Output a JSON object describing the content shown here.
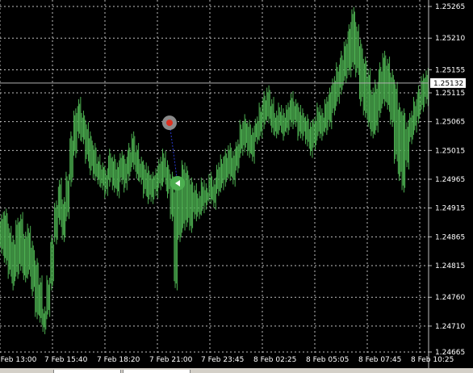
{
  "chart_data": {
    "type": "line",
    "title": "",
    "current_price": "1.25132",
    "price_ticks": [
      "1.25265",
      "1.25210",
      "1.25155",
      "1.25115",
      "1.25065",
      "1.25015",
      "1.24965",
      "1.24915",
      "1.24865",
      "1.24815",
      "1.24760",
      "1.24710",
      "1.24665"
    ],
    "time_ticks": [
      "7 Feb 13:00",
      "7 Feb 15:40",
      "7 Feb 18:20",
      "7 Feb 21:00",
      "7 Feb 23:45",
      "8 Feb 02:25",
      "8 Feb 05:05",
      "8 Feb 07:45",
      "8 Feb 10:25"
    ],
    "ylim": [
      1.2465,
      1.2528
    ],
    "grid": true,
    "bar_color": "#4caf50",
    "grid_color": "#c0c0c0",
    "price_line_color": "#b0b0b0",
    "series": [
      {
        "values": [
          [
            1.249,
            1.2484
          ],
          [
            1.2491,
            1.2482
          ],
          [
            1.2488,
            1.248
          ],
          [
            1.2486,
            1.2478
          ],
          [
            1.2489,
            1.248
          ],
          [
            1.249,
            1.2481
          ],
          [
            1.2487,
            1.2479
          ],
          [
            1.2488,
            1.248
          ],
          [
            1.2485,
            1.2477
          ],
          [
            1.2482,
            1.2473
          ],
          [
            1.2479,
            1.2472
          ],
          [
            1.2474,
            1.247
          ],
          [
            1.2479,
            1.2473
          ],
          [
            1.2486,
            1.2478
          ],
          [
            1.2492,
            1.2486
          ],
          [
            1.2496,
            1.2489
          ],
          [
            1.2493,
            1.2486
          ],
          [
            1.2497,
            1.249
          ],
          [
            1.2504,
            1.2496
          ],
          [
            1.2508,
            1.2501
          ],
          [
            1.251,
            1.2504
          ],
          [
            1.2508,
            1.2503
          ],
          [
            1.2506,
            1.25
          ],
          [
            1.2504,
            1.2498
          ],
          [
            1.2502,
            1.2497
          ],
          [
            1.25,
            1.2496
          ],
          [
            1.2499,
            1.2495
          ],
          [
            1.2498,
            1.2494
          ],
          [
            1.2501,
            1.2496
          ],
          [
            1.25,
            1.2495
          ],
          [
            1.2499,
            1.2494
          ],
          [
            1.2501,
            1.2496
          ],
          [
            1.25,
            1.2495
          ],
          [
            1.2502,
            1.2497
          ],
          [
            1.2504,
            1.2499
          ],
          [
            1.2502,
            1.2497
          ],
          [
            1.25,
            1.2496
          ],
          [
            1.2499,
            1.2494
          ],
          [
            1.2498,
            1.2493
          ],
          [
            1.2497,
            1.2493
          ],
          [
            1.2498,
            1.2494
          ],
          [
            1.25,
            1.2495
          ],
          [
            1.2501,
            1.2496
          ],
          [
            1.2499,
            1.2494
          ],
          [
            1.2497,
            1.249
          ],
          [
            1.2495,
            1.2478
          ],
          [
            1.2496,
            1.2486
          ],
          [
            1.2499,
            1.2488
          ],
          [
            1.2498,
            1.2489
          ],
          [
            1.2496,
            1.2488
          ],
          [
            1.2495,
            1.249
          ],
          [
            1.2494,
            1.249
          ],
          [
            1.2496,
            1.2491
          ],
          [
            1.2495,
            1.2492
          ],
          [
            1.2497,
            1.2493
          ],
          [
            1.2496,
            1.2492
          ],
          [
            1.2499,
            1.2494
          ],
          [
            1.25,
            1.2495
          ],
          [
            1.2501,
            1.2496
          ],
          [
            1.2502,
            1.2497
          ],
          [
            1.2501,
            1.2496
          ],
          [
            1.2503,
            1.2498
          ],
          [
            1.2506,
            1.2501
          ],
          [
            1.2507,
            1.2502
          ],
          [
            1.2506,
            1.2501
          ],
          [
            1.2505,
            1.25
          ],
          [
            1.2507,
            1.2503
          ],
          [
            1.2509,
            1.2504
          ],
          [
            1.2511,
            1.2506
          ],
          [
            1.2512,
            1.2507
          ],
          [
            1.251,
            1.2505
          ],
          [
            1.2508,
            1.2504
          ],
          [
            1.2509,
            1.2505
          ],
          [
            1.2508,
            1.2504
          ],
          [
            1.2509,
            1.2505
          ],
          [
            1.2511,
            1.2506
          ],
          [
            1.251,
            1.2506
          ],
          [
            1.2509,
            1.2504
          ],
          [
            1.2508,
            1.2504
          ],
          [
            1.2507,
            1.2503
          ],
          [
            1.2506,
            1.2501
          ],
          [
            1.2507,
            1.2502
          ],
          [
            1.2509,
            1.2504
          ],
          [
            1.2508,
            1.2504
          ],
          [
            1.251,
            1.2505
          ],
          [
            1.2512,
            1.2506
          ],
          [
            1.2514,
            1.2508
          ],
          [
            1.2516,
            1.251
          ],
          [
            1.2518,
            1.2512
          ],
          [
            1.252,
            1.2514
          ],
          [
            1.2523,
            1.2515
          ],
          [
            1.2526,
            1.2516
          ],
          [
            1.2523,
            1.2515
          ],
          [
            1.252,
            1.251
          ],
          [
            1.2517,
            1.2508
          ],
          [
            1.2515,
            1.2506
          ],
          [
            1.2512,
            1.2504
          ],
          [
            1.2513,
            1.2505
          ],
          [
            1.2516,
            1.2508
          ],
          [
            1.2518,
            1.251
          ],
          [
            1.2517,
            1.2509
          ],
          [
            1.2515,
            1.2506
          ],
          [
            1.2513,
            1.25
          ],
          [
            1.2509,
            1.2497
          ],
          [
            1.2508,
            1.2495
          ],
          [
            1.2506,
            1.2499
          ],
          [
            1.2508,
            1.2503
          ],
          [
            1.251,
            1.2505
          ],
          [
            1.2512,
            1.2507
          ],
          [
            1.2514,
            1.2509
          ],
          [
            1.2515,
            1.251
          ]
        ]
      }
    ],
    "trade": {
      "open_price": 1.24958,
      "close_price": 1.25063
    }
  }
}
